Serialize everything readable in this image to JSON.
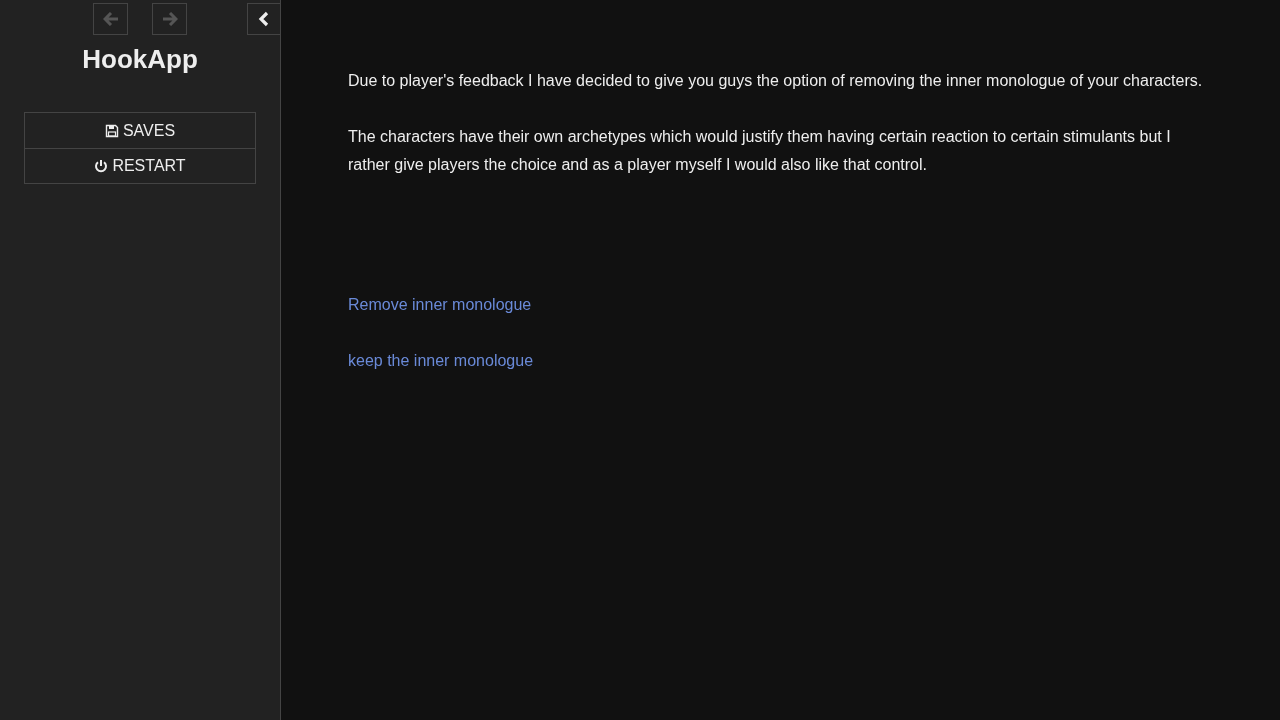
{
  "sidebar": {
    "history": [
      {
        "kind": "back",
        "disabled": true
      },
      {
        "kind": "forward",
        "disabled": true
      }
    ],
    "title": "HookApp",
    "menu": [
      {
        "kind": "saves",
        "label": "SAVES"
      },
      {
        "kind": "restart",
        "label": "RESTART"
      }
    ]
  },
  "passage": {
    "paragraphs": [
      "Due to player's feedback I have decided to give you guys the option of removing the inner monologue of your characters.",
      "The characters have their own archetypes which would justify them having certain reaction to certain stimulants but I rather give players the choice and as a player myself I would also like that control."
    ],
    "links": [
      "Remove inner monologue",
      "keep the inner monologue"
    ]
  }
}
